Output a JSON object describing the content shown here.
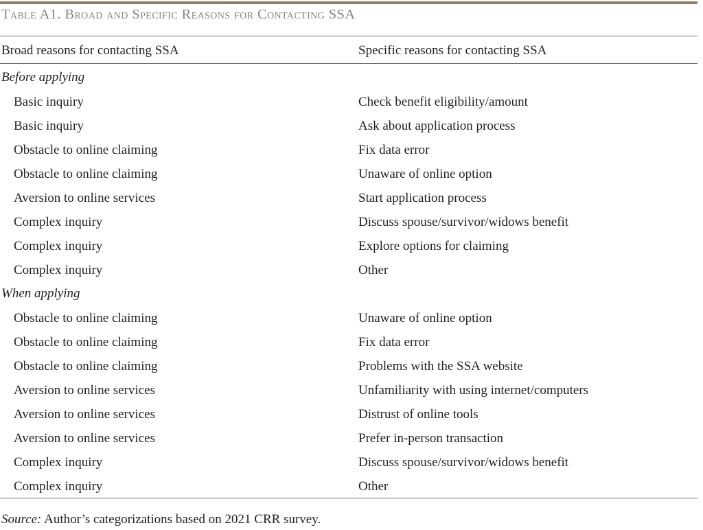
{
  "colors": {
    "title": "#8b8275",
    "top_rule": "#8a8068",
    "rule": "#6f6f6f",
    "text": "#231f20"
  },
  "title": "Table A1. Broad and Specific Reasons for Contacting SSA",
  "columns": {
    "broad_header": "Broad reasons for contacting SSA",
    "specific_header": "Specific reasons for contacting SSA"
  },
  "sections": [
    {
      "heading": "Before applying",
      "rows": [
        {
          "broad": "Basic inquiry",
          "specific": "Check benefit eligibility/amount"
        },
        {
          "broad": "Basic inquiry",
          "specific": "Ask about application process"
        },
        {
          "broad": "Obstacle to online claiming",
          "specific": "Fix data error"
        },
        {
          "broad": "Obstacle to online claiming",
          "specific": "Unaware of online option"
        },
        {
          "broad": "Aversion to online services",
          "specific": "Start application process"
        },
        {
          "broad": "Complex inquiry",
          "specific": "Discuss spouse/survivor/widows benefit"
        },
        {
          "broad": "Complex inquiry",
          "specific": "Explore options for claiming"
        },
        {
          "broad": "Complex inquiry",
          "specific": "Other"
        }
      ]
    },
    {
      "heading": "When applying",
      "rows": [
        {
          "broad": "Obstacle to online claiming",
          "specific": "Unaware of online option"
        },
        {
          "broad": "Obstacle to online claiming",
          "specific": "Fix data error"
        },
        {
          "broad": "Obstacle to online claiming",
          "specific": "Problems with the SSA website"
        },
        {
          "broad": "Aversion to online services",
          "specific": "Unfamiliarity with using internet/computers"
        },
        {
          "broad": "Aversion to online services",
          "specific": "Distrust of online tools"
        },
        {
          "broad": "Aversion to online services",
          "specific": "Prefer in-person transaction"
        },
        {
          "broad": "Complex inquiry",
          "specific": "Discuss spouse/survivor/widows benefit"
        },
        {
          "broad": "Complex inquiry",
          "specific": "Other"
        }
      ]
    }
  ],
  "source": {
    "label": "Source:",
    "text": " Author’s categorizations based on 2021 CRR survey."
  }
}
